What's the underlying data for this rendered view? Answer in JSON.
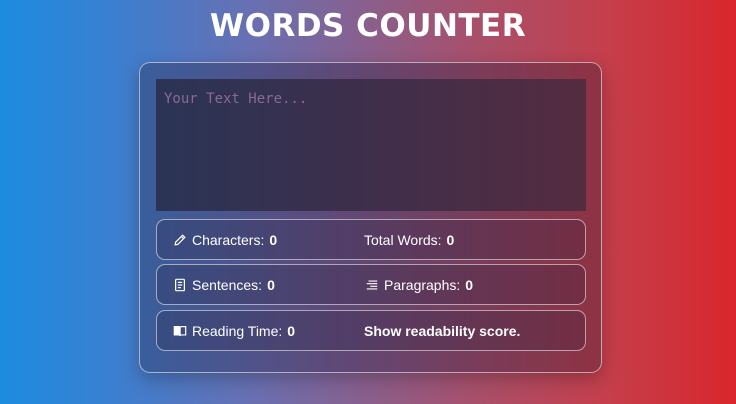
{
  "title": "WORDS COUNTER",
  "input": {
    "placeholder": "Your Text Here...",
    "value": ""
  },
  "stats": {
    "characters": {
      "label": "Characters:",
      "value": "0",
      "icon": "pencil-icon"
    },
    "total_words": {
      "label": "Total Words:",
      "value": "0"
    },
    "sentences": {
      "label": "Sentences:",
      "value": "0",
      "icon": "document-icon"
    },
    "paragraphs": {
      "label": "Paragraphs:",
      "value": "0",
      "icon": "align-right-icon"
    },
    "reading_time": {
      "label": "Reading Time:",
      "value": "0",
      "icon": "book-icon"
    }
  },
  "readability_link": "Show readability score.",
  "colors": {
    "gradient_left": "#1c8ce0",
    "gradient_right": "#d9262c",
    "text": "#ffffff"
  }
}
